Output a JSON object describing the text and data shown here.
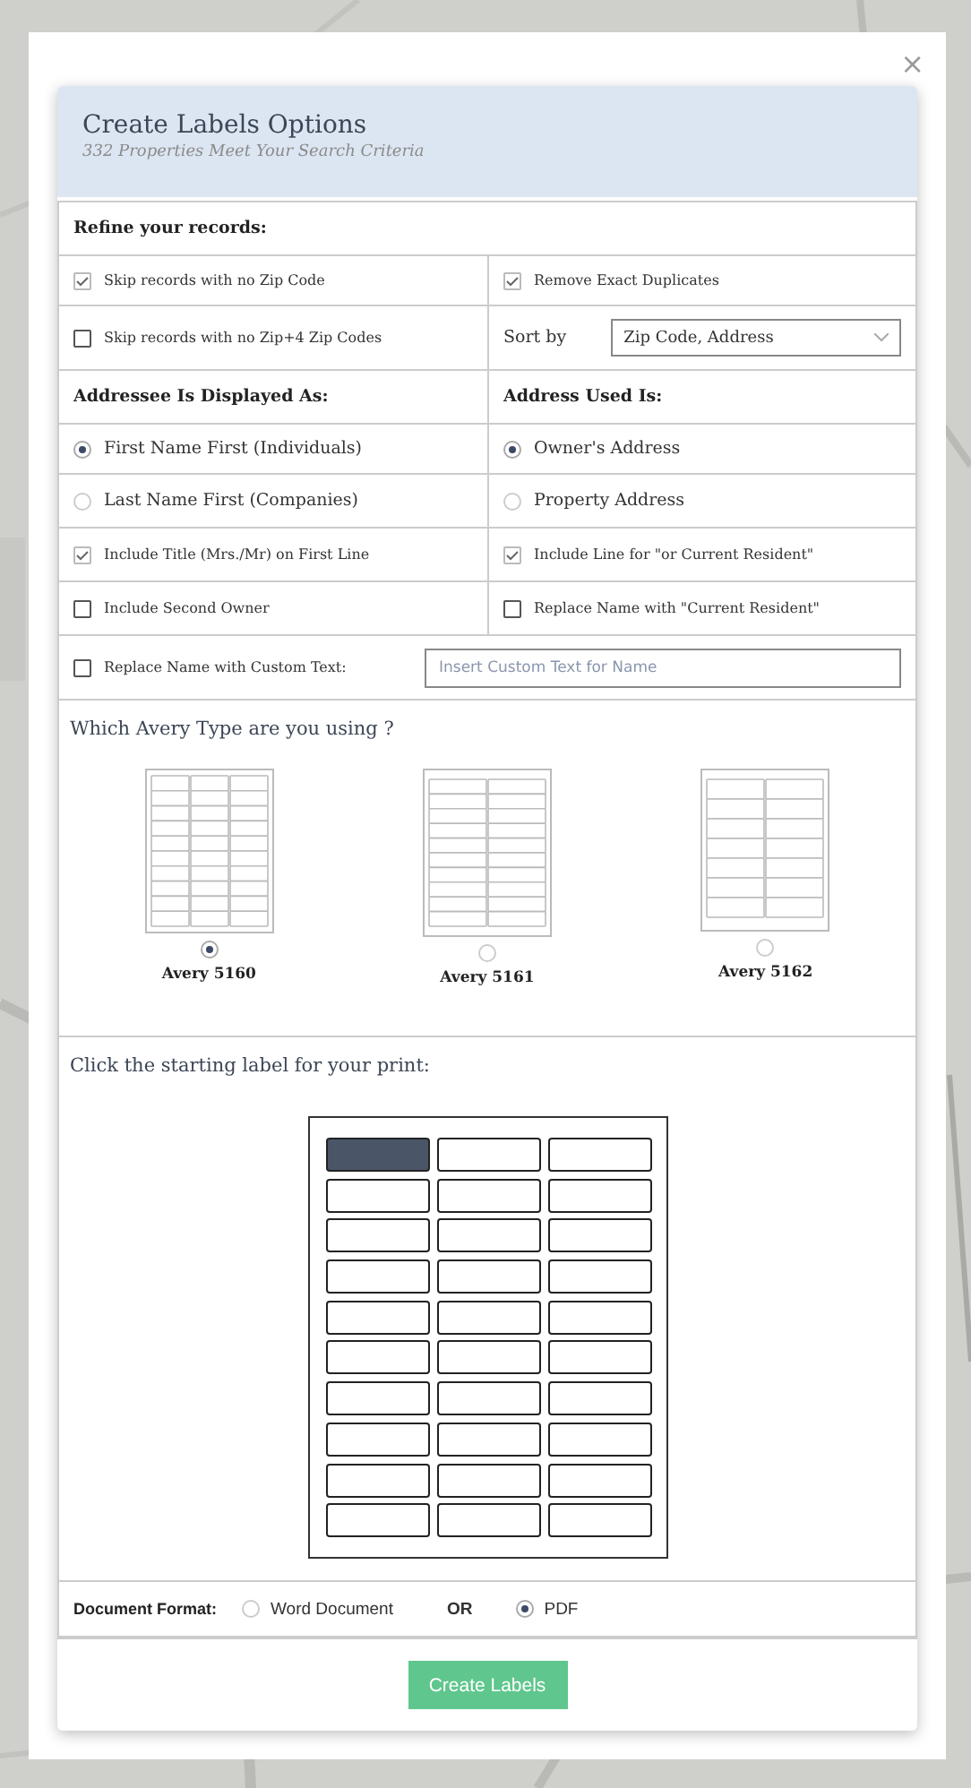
{
  "dialog": {
    "title": "Create Labels Options",
    "subtitle": "332 Properties Meet Your Search Criteria",
    "close": "×"
  },
  "refine": {
    "heading": "Refine your records:",
    "rows": [
      [
        {
          "kind": "checkbox",
          "label": "Skip records with no Zip Code",
          "checked": true
        },
        {
          "kind": "checkbox",
          "label": "Remove Exact Duplicates",
          "checked": true
        }
      ],
      [
        {
          "kind": "checkbox",
          "label": "Skip records with no Zip+4 Zip Codes",
          "checked": false
        },
        {
          "kind": "select",
          "label": "Sort by",
          "value": "Zip Code, Address"
        }
      ]
    ]
  },
  "display": {
    "headings": [
      "Addressee Is Displayed As:",
      "Address Used Is:"
    ],
    "rows": [
      [
        {
          "kind": "radio",
          "label": "First Name First (Individuals)",
          "selected": true
        },
        {
          "kind": "radio",
          "label": "Owner's Address",
          "selected": true
        }
      ],
      [
        {
          "kind": "radio",
          "label": "Last Name First (Companies)",
          "selected": false
        },
        {
          "kind": "radio",
          "label": "Property Address",
          "selected": false
        }
      ],
      [
        {
          "kind": "checkbox",
          "label": "Include Title (Mrs./Mr) on First Line",
          "checked": true
        },
        {
          "kind": "checkbox",
          "label": "Include Line for \"or Current Resident\"",
          "checked": true
        }
      ],
      [
        {
          "kind": "checkbox",
          "label": "Include Second Owner",
          "checked": false
        },
        {
          "kind": "checkbox",
          "label": "Replace Name with \"Current Resident\"",
          "checked": false
        }
      ]
    ]
  },
  "custom": {
    "label": "Replace Name with Custom Text:",
    "checked": false,
    "placeholder": "Insert Custom Text for Name"
  },
  "avery": {
    "heading": "Which Avery Type are you using ?",
    "types": [
      {
        "kind": "thirty",
        "label": "Avery 5160",
        "selected": true
      },
      {
        "kind": "twenty",
        "label": "Avery 5161",
        "selected": false
      },
      {
        "kind": "fourteen",
        "label": "Avery 5162",
        "selected": false
      }
    ]
  },
  "start": {
    "heading": "Click the starting label for your print:",
    "cells": [
      {
        "selected": true
      },
      {
        "selected": false
      },
      {
        "selected": false
      },
      {
        "selected": false
      },
      {
        "selected": false
      },
      {
        "selected": false
      },
      {
        "selected": false
      },
      {
        "selected": false
      },
      {
        "selected": false
      },
      {
        "selected": false
      },
      {
        "selected": false
      },
      {
        "selected": false
      },
      {
        "selected": false
      },
      {
        "selected": false
      },
      {
        "selected": false
      },
      {
        "selected": false
      },
      {
        "selected": false
      },
      {
        "selected": false
      },
      {
        "selected": false
      },
      {
        "selected": false
      },
      {
        "selected": false
      },
      {
        "selected": false
      },
      {
        "selected": false
      },
      {
        "selected": false
      },
      {
        "selected": false
      },
      {
        "selected": false
      },
      {
        "selected": false
      },
      {
        "selected": false
      },
      {
        "selected": false
      },
      {
        "selected": false
      }
    ]
  },
  "format": {
    "label": "Document Format:",
    "separator": "OR",
    "options": [
      {
        "label": "Word Document",
        "selected": false
      },
      {
        "label": "PDF",
        "selected": true
      }
    ]
  },
  "button": "Create Labels"
}
